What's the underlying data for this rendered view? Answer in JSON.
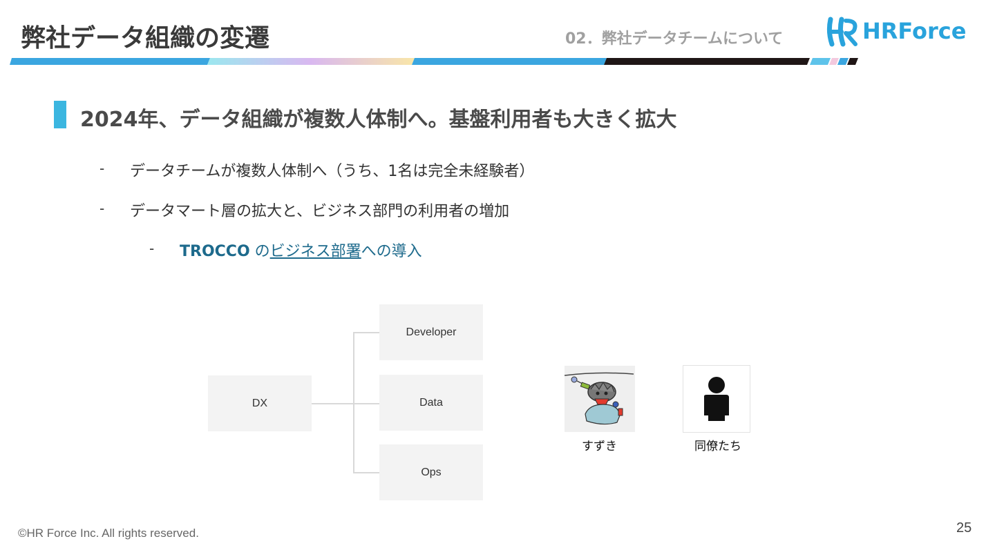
{
  "slide": {
    "title": "弊社データ組織の変遷",
    "section": "02．弊社データチームについて",
    "logo_text": "HRForce",
    "heading": "2024年、データ組織が複数人体制へ。基盤利用者も大きく拡大",
    "bullets": [
      {
        "dash": "-",
        "text": "データチームが複数人体制へ（うち、1名は完全未経験者）"
      },
      {
        "dash": "-",
        "text": "データマート層の拡大と、ビジネス部門の利用者の増加"
      }
    ],
    "sub_bullet": {
      "dash": "-",
      "strong": "TROCCO",
      "mid": " の",
      "link": "ビジネス部署",
      "tail": "への導入"
    },
    "org": {
      "root": "DX",
      "children": [
        "Developer",
        "Data",
        "Ops"
      ]
    },
    "people": [
      {
        "name": "すずき",
        "icon": "character-illustration-icon"
      },
      {
        "name": "同僚たち",
        "icon": "person-silhouette-icon"
      }
    ],
    "footer": "©HR Force Inc. All rights reserved.",
    "page_number": "25",
    "colors": {
      "accent": "#3bb6e0",
      "logo": "#29a3dc",
      "link": "#1d6a8c"
    }
  }
}
